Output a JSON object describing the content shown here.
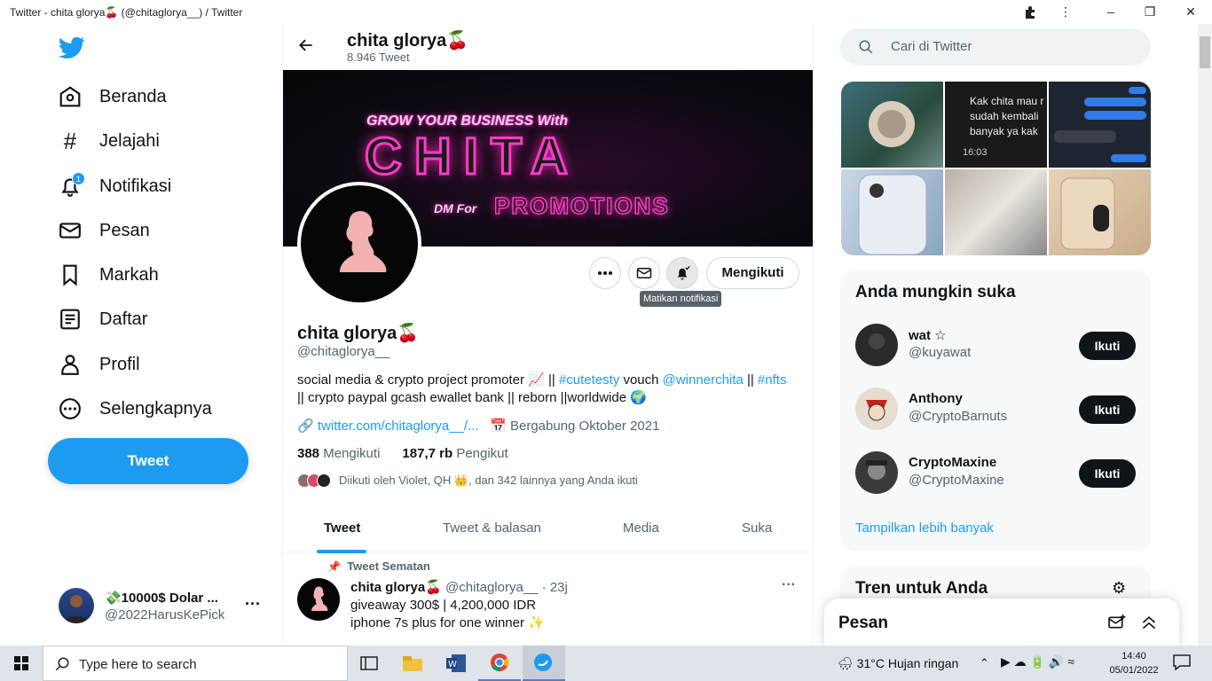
{
  "window": {
    "title": "Twitter - chita glorya🍒 (@chitaglorya__) / Twitter"
  },
  "colors": {
    "accent": "#1d9bf0",
    "text": "#0f1419",
    "muted": "#536471"
  },
  "sidebar": {
    "notification_count": "1",
    "items": [
      {
        "label": "Beranda",
        "icon": "home-icon"
      },
      {
        "label": "Jelajahi",
        "icon": "hashtag-icon"
      },
      {
        "label": "Notifikasi",
        "icon": "bell-icon"
      },
      {
        "label": "Pesan",
        "icon": "envelope-icon"
      },
      {
        "label": "Markah",
        "icon": "bookmark-icon"
      },
      {
        "label": "Daftar",
        "icon": "list-icon"
      },
      {
        "label": "Profil",
        "icon": "person-icon"
      },
      {
        "label": "Selengkapnya",
        "icon": "more-circle-icon"
      }
    ],
    "tweet_button": "Tweet",
    "account": {
      "name": "💸10000$ Dolar ...",
      "handle": "@2022HarusKePick"
    }
  },
  "profile": {
    "header_name": "chita glorya🍒",
    "tweet_count": "8.946 Tweet",
    "banner": {
      "line1": "GROW YOUR BUSINESS With",
      "line2": "CHITA",
      "line3": "DM For",
      "line4": "PROMOTIONS"
    },
    "follow_button": "Mengikuti",
    "tooltip": "Matikan notifikasi",
    "name": "chita glorya🍒",
    "handle": "@chitaglorya__",
    "bio": {
      "p1": "social media & crypto project promoter 📈 || ",
      "tag1": "#cutetesty",
      "p2": " vouch ",
      "mention": "@winnerchita",
      "p3": " || ",
      "tag2": "#nfts",
      "p4": "|| crypto paypal gcash ewallet bank || reborn ||worldwide 🌍"
    },
    "website": "twitter.com/chitaglorya__/...",
    "joined": "Bergabung Oktober 2021",
    "following_count": "388",
    "following_label": "Mengikuti",
    "followers_count": "187,7 rb",
    "followers_label": "Pengikut",
    "followed_by": "Diikuti oleh Violet, QH 👑, dan 342 lainnya yang Anda ikuti"
  },
  "tabs": [
    "Tweet",
    "Tweet & balasan",
    "Media",
    "Suka"
  ],
  "pinned_tweet": {
    "label": "Tweet Sematan",
    "name": "chita glorya🍒",
    "handle_time": "@chitaglorya__ · 23j",
    "line1": "giveaway 300$ | 4,200,000 IDR",
    "line2": "iphone 7s plus for one winner ✨"
  },
  "right": {
    "search_placeholder": "Cari di Twitter",
    "media_grid_text": {
      "chat": "Kak chita mau r sudah kembali banyak ya kak",
      "time": "16:03"
    },
    "suggestions_title": "Anda mungkin suka",
    "suggestions": [
      {
        "name": "wat ☆",
        "handle": "@kuyawat",
        "button": "Ikuti"
      },
      {
        "name": "Anthony",
        "handle": "@CryptoBarnuts",
        "button": "Ikuti"
      },
      {
        "name": "CryptoMaxine",
        "handle": "@CryptoMaxine",
        "button": "Ikuti"
      }
    ],
    "show_more": "Tampilkan lebih banyak",
    "trends_title": "Tren untuk Anda",
    "dm_title": "Pesan"
  },
  "taskbar": {
    "search_placeholder": "Type here to search",
    "weather": "31°C  Hujan ringan",
    "time": "14:40",
    "date": "05/01/2022"
  }
}
